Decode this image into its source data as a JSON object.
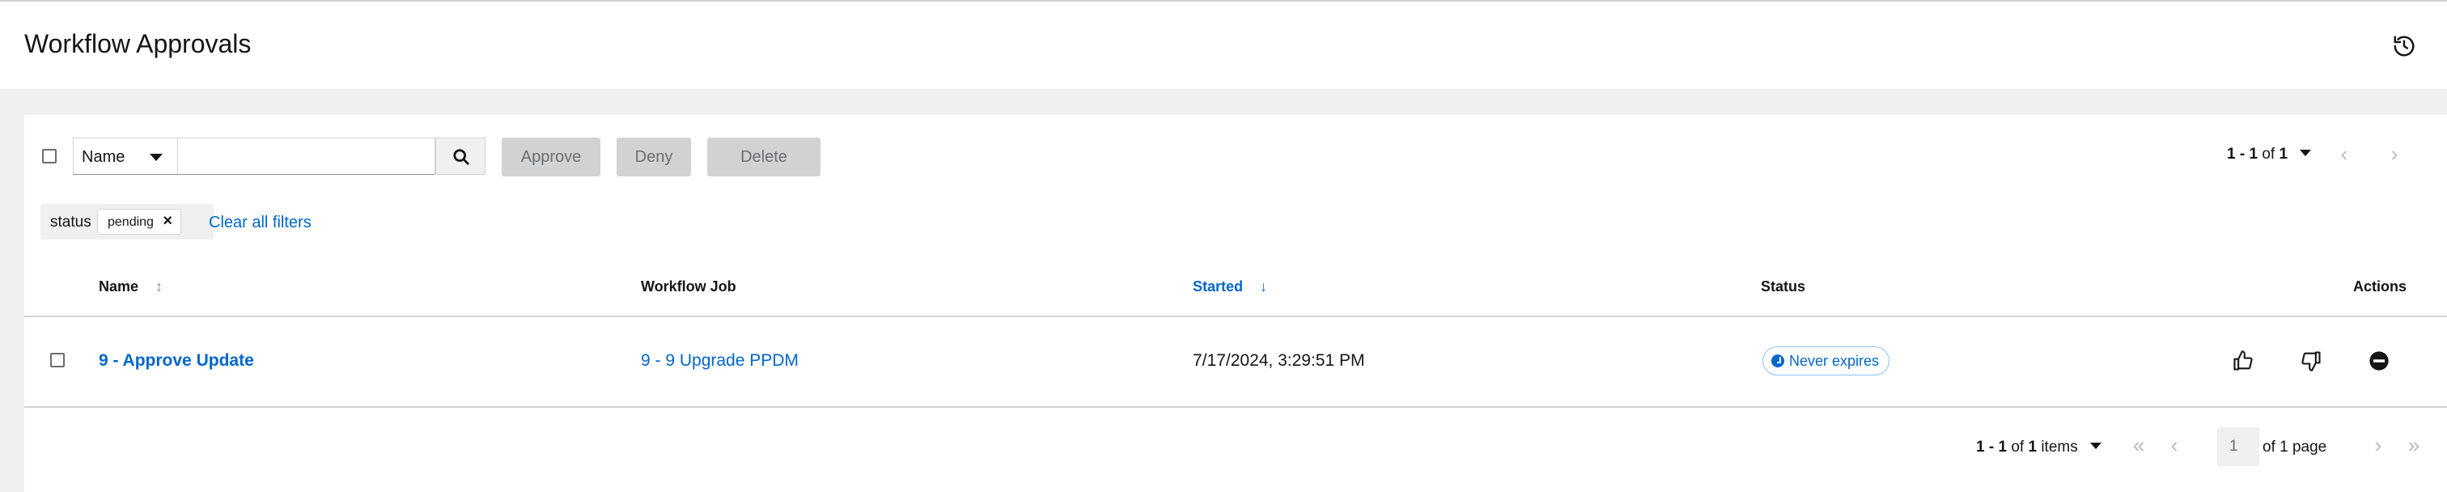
{
  "header": {
    "title": "Workflow Approvals",
    "history_icon": "history-icon"
  },
  "toolbar": {
    "filter_field": "Name",
    "search_value": "",
    "search_icon": "search-icon",
    "approve_label": "Approve",
    "deny_label": "Deny",
    "delete_label": "Delete",
    "pagination": {
      "range": "1 - 1",
      "of": "of",
      "total": "1"
    }
  },
  "filters": {
    "category": "status",
    "chip": "pending",
    "clear_label": "Clear all filters"
  },
  "table": {
    "columns": [
      {
        "label": "Name",
        "sort": "none"
      },
      {
        "label": "Workflow Job",
        "sort": "none"
      },
      {
        "label": "Started",
        "sort": "descending"
      },
      {
        "label": "Status",
        "sort": "none"
      },
      {
        "label": "Actions",
        "sort": "none"
      }
    ],
    "rows": [
      {
        "name": "9 - Approve Update",
        "workflow_job": "9 - 9 Upgrade PPDM",
        "started": "7/17/2024, 3:29:51 PM",
        "status": "Never expires",
        "actions": [
          "thumbs-up-icon",
          "thumbs-down-icon",
          "minus-circle-icon"
        ]
      }
    ]
  },
  "footer_pagination": {
    "range": "1 - 1",
    "of": "of",
    "total": "1",
    "items": "items",
    "current_page": "1",
    "of_pages": "of 1 page"
  },
  "colors": {
    "link": "#0066cc",
    "disabled_button": "#d2d2d2",
    "background": "#f0f0f0"
  }
}
